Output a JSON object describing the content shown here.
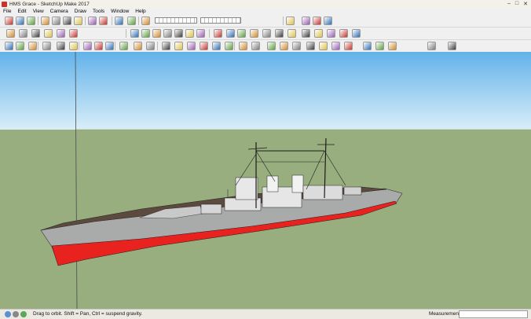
{
  "window": {
    "title": "HMS Grace - SketchUp Make 2017"
  },
  "menu": [
    "File",
    "Edit",
    "View",
    "Camera",
    "Draw",
    "Tools",
    "Window",
    "Help"
  ],
  "statusbar": {
    "hint": "Drag to orbit. Shift = Pan, Ctrl = suspend gravity.",
    "measurements_label": "Measurements",
    "measurements_value": ""
  },
  "toolbars": {
    "row1": [
      "new-icon",
      "open-icon",
      "save-icon",
      "cut-icon",
      "copy-icon",
      "paste-icon",
      "erase-icon",
      "undo-icon",
      "redo-icon",
      "print-icon",
      "model-info-icon",
      "shadow-icon",
      "shadow-date-slider",
      "shadow-time-slider",
      "warehouse-icon",
      "extension-icon",
      "components-icon",
      "styles-icon"
    ],
    "row2": [
      "select-icon",
      "paint-icon",
      "push-pull-icon",
      "move-icon",
      "rotate-icon",
      "scale-icon",
      "xray-icon",
      "back-edges-icon",
      "wireframe-icon",
      "hidden-line-icon",
      "shaded-icon",
      "textured-icon",
      "monochrome-icon",
      "iso-view-icon",
      "top-view-icon",
      "front-view-icon",
      "right-view-icon",
      "back-view-icon",
      "left-view-icon",
      "bottom-view-icon"
    ],
    "row3": [
      "arrow-icon",
      "eraser-icon",
      "pencil-icon",
      "line-icon",
      "arc-icon",
      "rectangle-icon",
      "circle-icon",
      "polygon-icon",
      "offset-icon",
      "tape-icon",
      "dimension-icon",
      "text-icon",
      "axes-icon",
      "orbit-icon",
      "pan-icon",
      "zoom-icon",
      "zoom-window-icon",
      "zoom-extents-icon",
      "walk-icon",
      "look-around-icon"
    ]
  },
  "colors": {
    "hull_red": "#e8221f",
    "hull_gray": "#a7a9a9",
    "deck": "#5b4a3d",
    "sky_top": "#6cb7ec",
    "sky_bottom": "#d7ecf7",
    "ground": "#97ae7e"
  }
}
